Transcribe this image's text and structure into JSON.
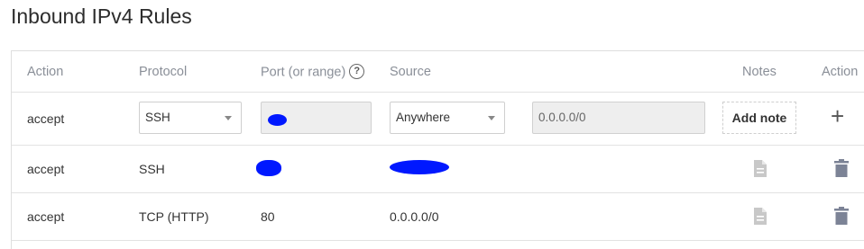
{
  "title": "Inbound IPv4 Rules",
  "columns": {
    "action": "Action",
    "protocol": "Protocol",
    "port": "Port (or range)",
    "help_glyph": "?",
    "source": "Source",
    "notes": "Notes",
    "actions": "Action"
  },
  "new_rule": {
    "action": "accept",
    "protocol_selected": "SSH",
    "source_selected": "Anywhere",
    "source_value": "0.0.0.0/0",
    "add_note_label": "Add note",
    "add_glyph": "+"
  },
  "rules": [
    {
      "action": "accept",
      "protocol": "SSH",
      "port": "",
      "source": ""
    },
    {
      "action": "accept",
      "protocol": "TCP (HTTP)",
      "port": "80",
      "source": "0.0.0.0/0"
    }
  ],
  "icons": {
    "help": "question-circle-icon",
    "note": "note-document-icon",
    "delete": "trash-icon",
    "add": "plus-icon",
    "dropdown": "chevron-down-icon"
  },
  "colors": {
    "header_text": "#8a8f98",
    "redaction": "#0018ff",
    "icon_disabled": "#c8c8c8",
    "icon_delete": "#7c8396"
  }
}
